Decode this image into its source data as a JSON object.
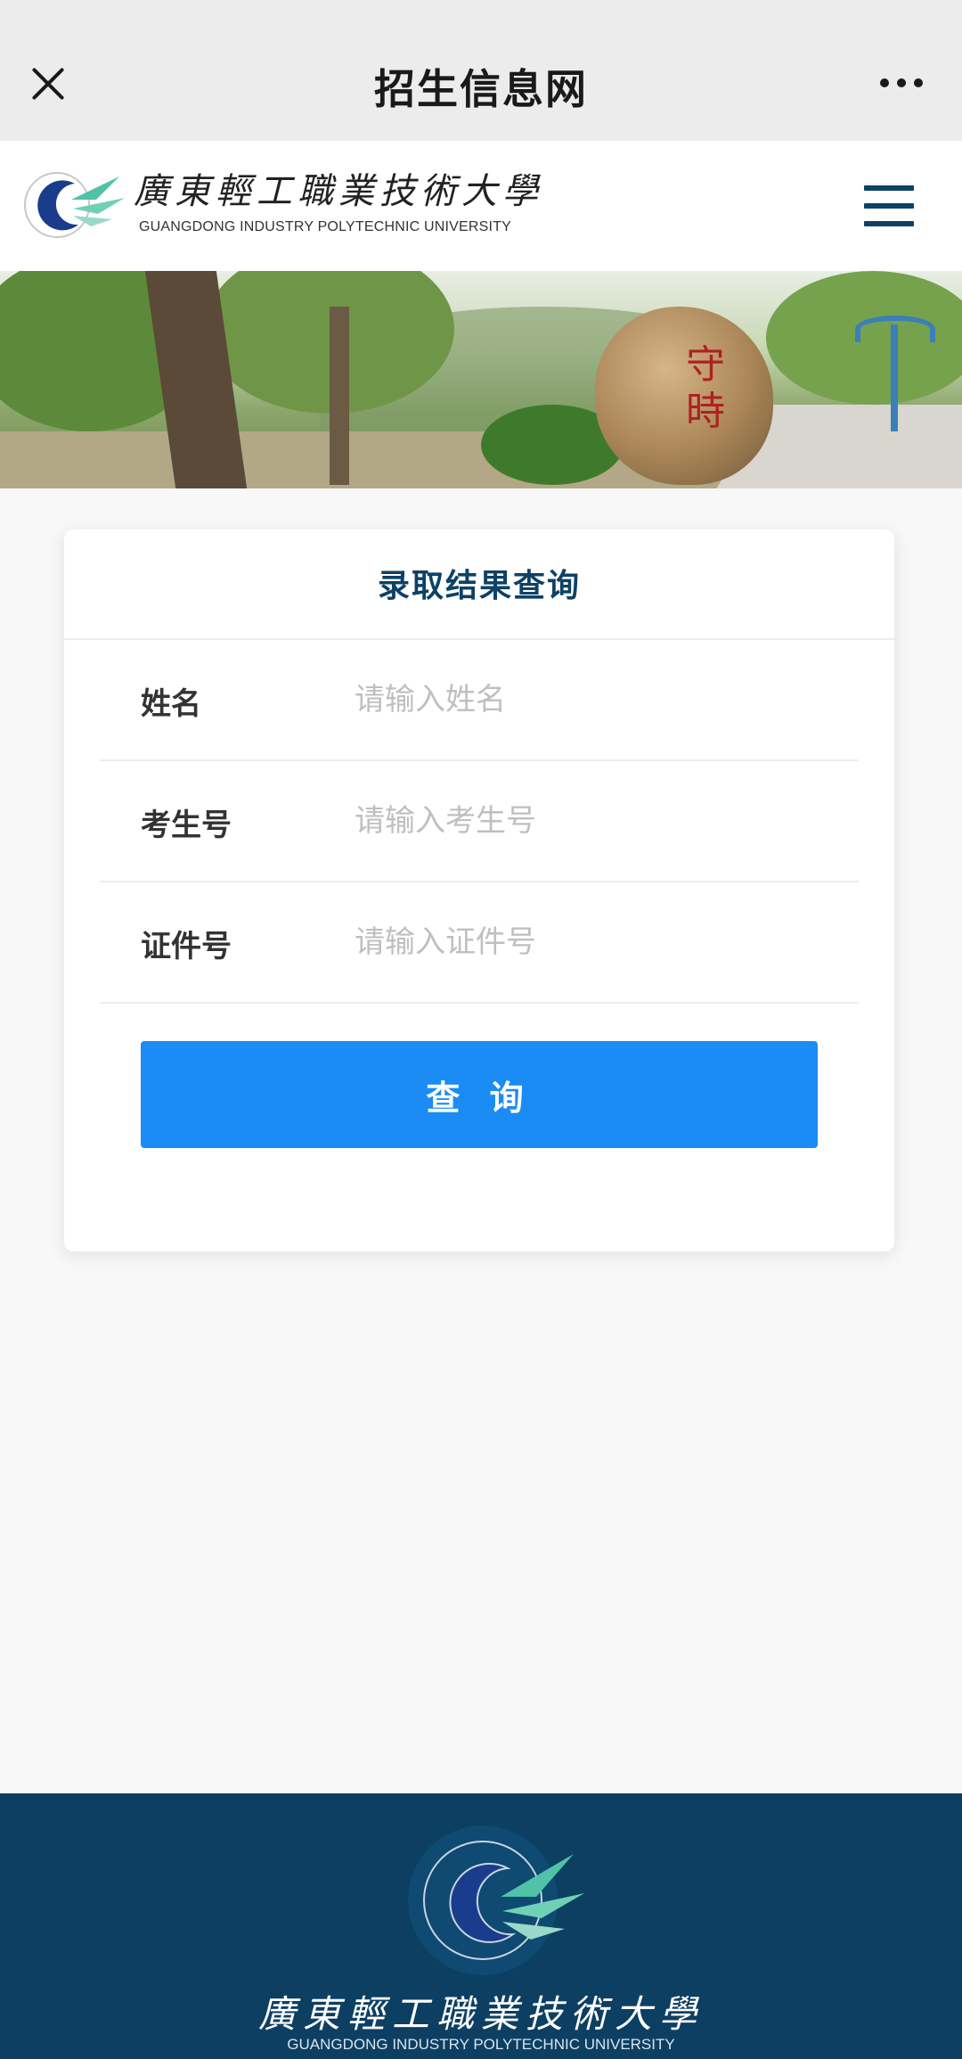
{
  "topbar": {
    "title": "招生信息网",
    "close_icon": "close-icon",
    "more_icon": "more-dots-icon"
  },
  "header": {
    "logo_cn": "廣東輕工職業技術大學",
    "logo_en": "GUANGDONG INDUSTRY POLYTECHNIC UNIVERSITY",
    "menu_icon": "hamburger-menu-icon",
    "logo_colors": {
      "primary": "#1a3c8c",
      "accent": "#4fc2a8"
    }
  },
  "banner": {
    "rock_text": "守時"
  },
  "form": {
    "title": "录取结果查询",
    "fields": [
      {
        "label": "姓名",
        "placeholder": "请输入姓名",
        "value": ""
      },
      {
        "label": "考生号",
        "placeholder": "请输入考生号",
        "value": ""
      },
      {
        "label": "证件号",
        "placeholder": "请输入证件号",
        "value": ""
      }
    ],
    "submit_label": "查 询",
    "submit_color": "#1b8cf5"
  },
  "footer": {
    "cn": "廣東輕工職業技術大學",
    "en": "GUANGDONG INDUSTRY POLYTECHNIC UNIVERSITY",
    "background": "#0d3f62"
  }
}
